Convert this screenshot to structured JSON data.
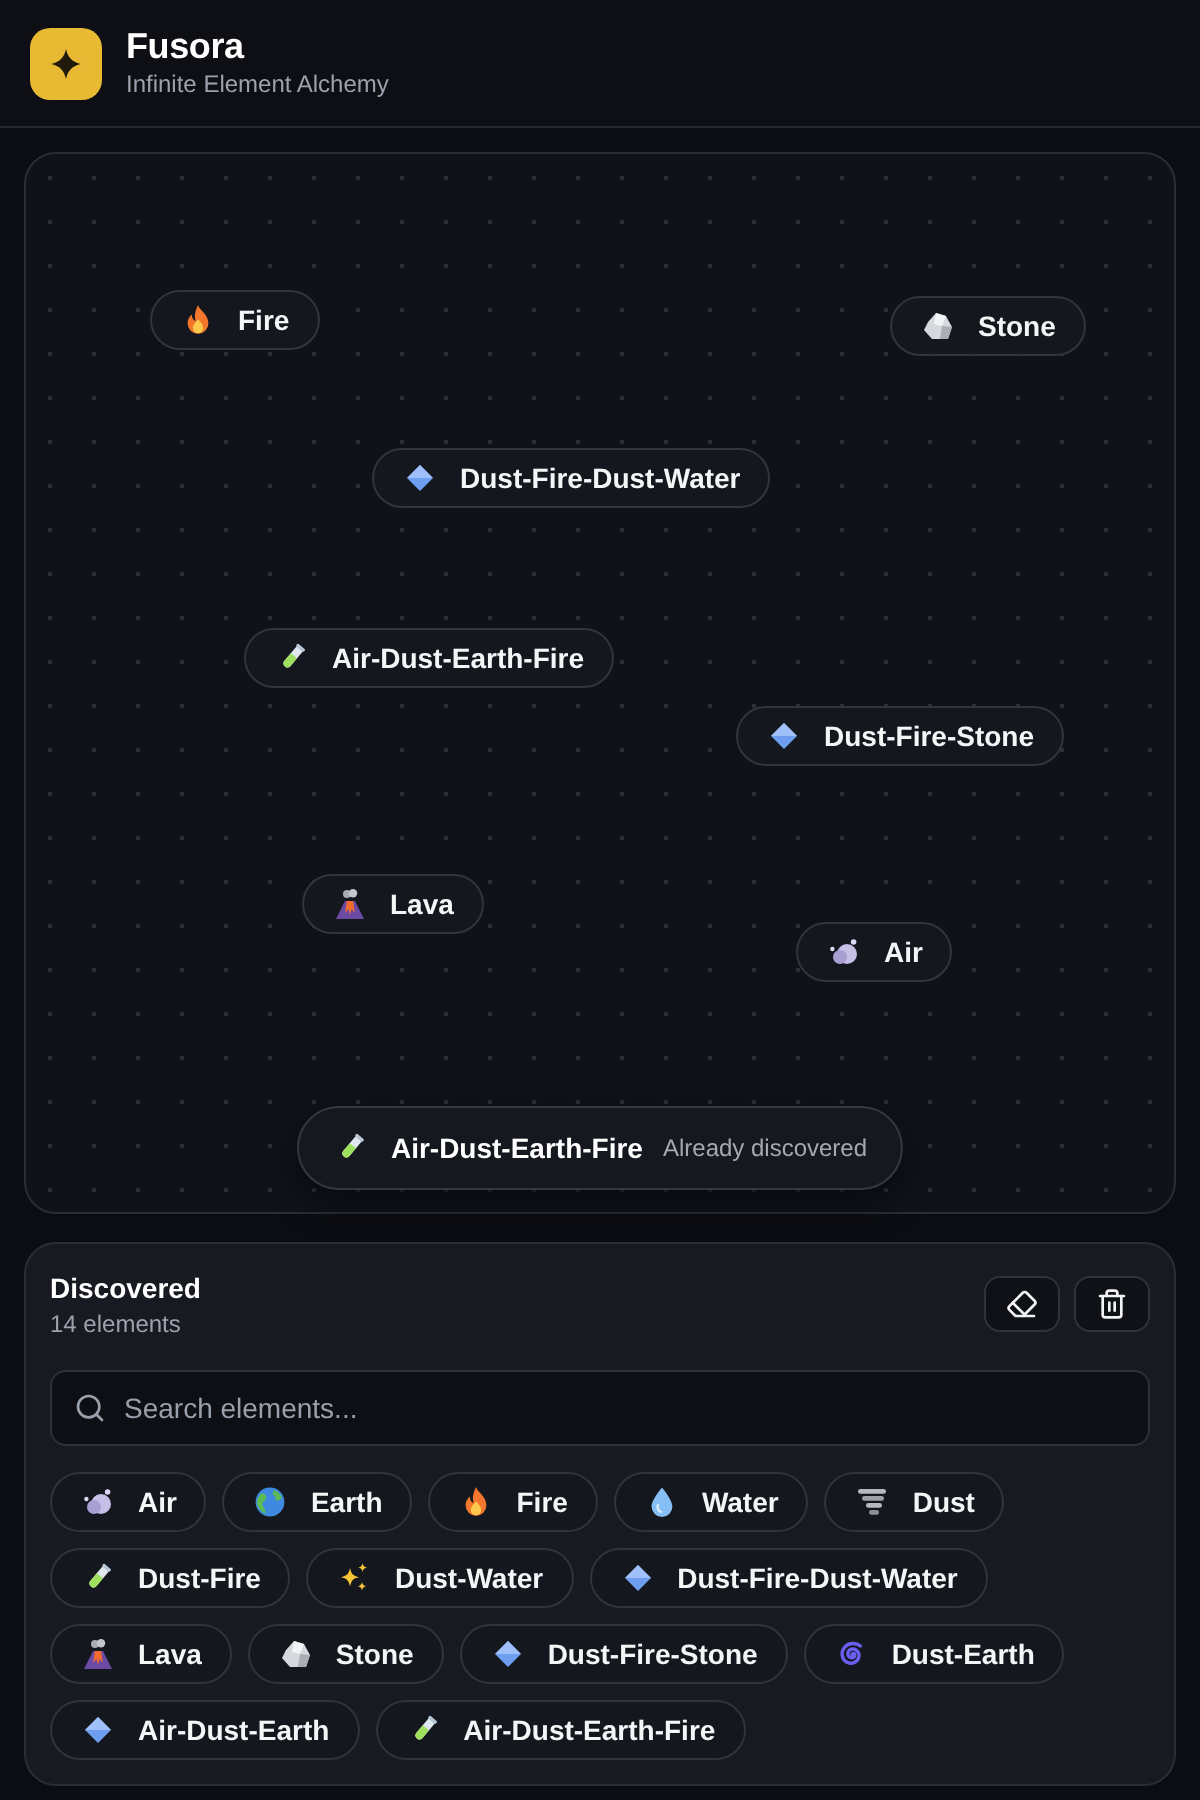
{
  "app": {
    "title": "Fusora",
    "subtitle": "Infinite Element Alchemy"
  },
  "canvas": {
    "nodes": [
      {
        "label": "Fire",
        "kind": "fire"
      },
      {
        "label": "Stone",
        "kind": "rock"
      },
      {
        "label": "Dust-Fire-Dust-Water",
        "kind": "diamond"
      },
      {
        "label": "Air-Dust-Earth-Fire",
        "kind": "tube"
      },
      {
        "label": "Dust-Fire-Stone",
        "kind": "diamond"
      },
      {
        "label": "Lava",
        "kind": "volcano"
      },
      {
        "label": "Air",
        "kind": "puff"
      }
    ],
    "toast": {
      "label": "Air-Dust-Earth-Fire",
      "kind": "tube",
      "note": "Already discovered"
    }
  },
  "discovered": {
    "title": "Discovered",
    "count": "14 elements",
    "search": {
      "placeholder": "Search elements..."
    },
    "elements": [
      {
        "label": "Air",
        "kind": "puff"
      },
      {
        "label": "Earth",
        "kind": "globe"
      },
      {
        "label": "Fire",
        "kind": "fire"
      },
      {
        "label": "Water",
        "kind": "drop"
      },
      {
        "label": "Dust",
        "kind": "tornado"
      },
      {
        "label": "Dust-Fire",
        "kind": "tube"
      },
      {
        "label": "Dust-Water",
        "kind": "sparkles"
      },
      {
        "label": "Dust-Fire-Dust-Water",
        "kind": "diamond"
      },
      {
        "label": "Lava",
        "kind": "volcano"
      },
      {
        "label": "Stone",
        "kind": "rock"
      },
      {
        "label": "Dust-Fire-Stone",
        "kind": "diamond"
      },
      {
        "label": "Dust-Earth",
        "kind": "spiral"
      },
      {
        "label": "Air-Dust-Earth",
        "kind": "diamond"
      },
      {
        "label": "Air-Dust-Earth-Fire",
        "kind": "tube"
      }
    ]
  }
}
